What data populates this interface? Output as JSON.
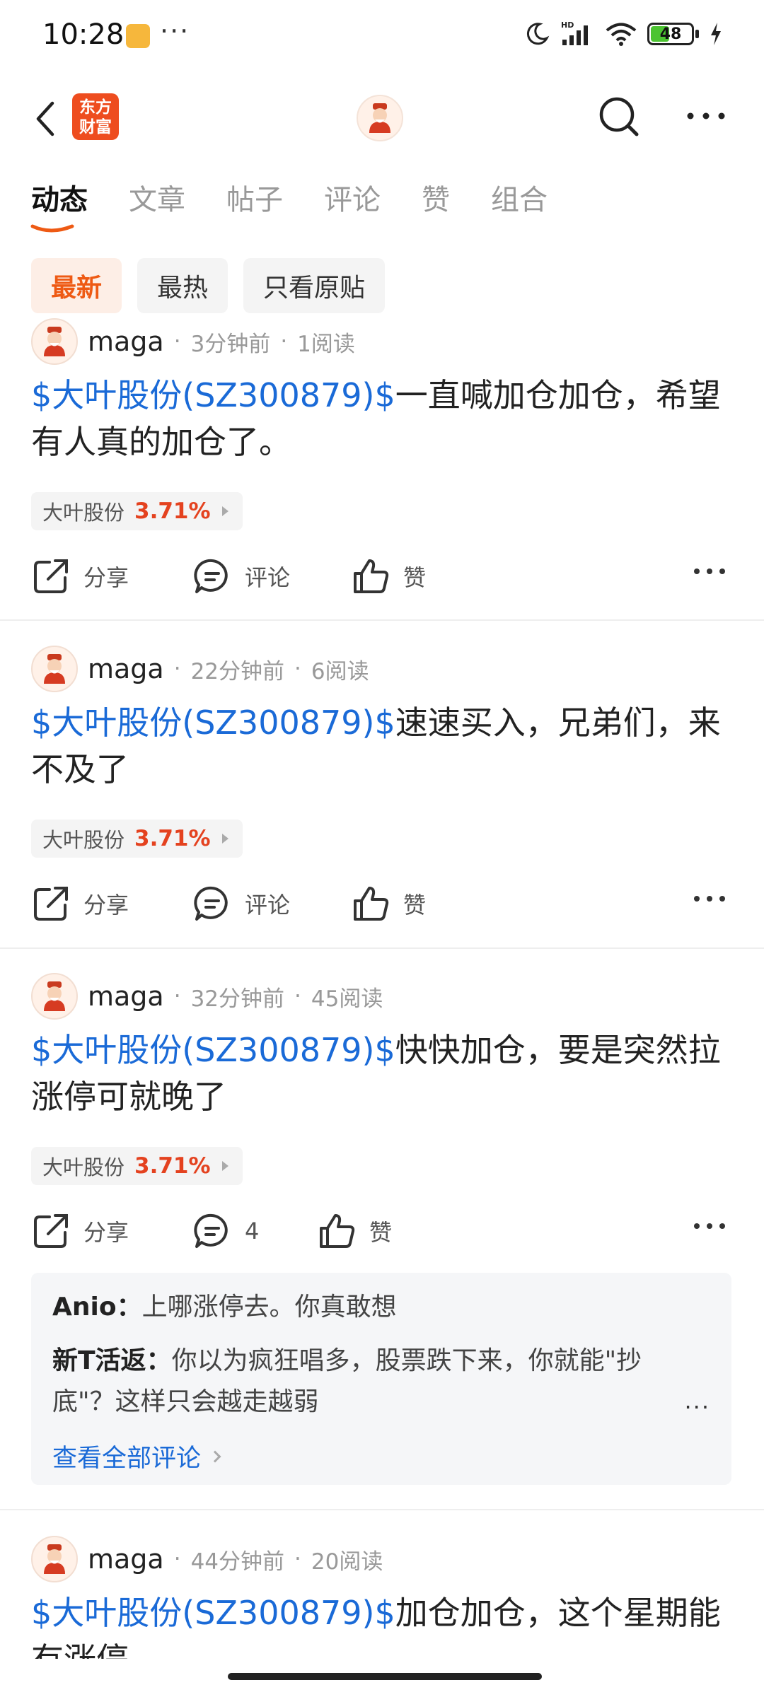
{
  "status_bar": {
    "time": "10:28",
    "more": "···",
    "signal_label": "HD",
    "battery": "48"
  },
  "nav": {
    "brand_text": "东方\n财富"
  },
  "tabs": [
    {
      "label": "动态",
      "active": true
    },
    {
      "label": "文章"
    },
    {
      "label": "帖子"
    },
    {
      "label": "评论"
    },
    {
      "label": "赞"
    },
    {
      "label": "组合"
    }
  ],
  "filters": [
    {
      "label": "最新",
      "active": true
    },
    {
      "label": "最热"
    },
    {
      "label": "只看原贴"
    }
  ],
  "colors": {
    "accent": "#ee5a14",
    "link": "#1a6ad7",
    "rise": "#e4421f"
  },
  "actions": {
    "share": "分享",
    "comment": "评论",
    "like": "赞"
  },
  "posts": [
    {
      "user": "maga",
      "time": "3分钟前",
      "reads": "1阅读",
      "stock_link": "$大叶股份(SZ300879)$",
      "text": "一直喊加仓加仓，希望有人真的加仓了。",
      "tag_name": "大叶股份",
      "tag_pct": "3.71%"
    },
    {
      "user": "maga",
      "time": "22分钟前",
      "reads": "6阅读",
      "stock_link": "$大叶股份(SZ300879)$",
      "text": "速速买入，兄弟们，来不及了",
      "tag_name": "大叶股份",
      "tag_pct": "3.71%"
    },
    {
      "user": "maga",
      "time": "32分钟前",
      "reads": "45阅读",
      "stock_link": "$大叶股份(SZ300879)$",
      "text": "快快加仓，要是突然拉涨停可就晚了",
      "tag_name": "大叶股份",
      "tag_pct": "3.71%",
      "comment_count": "4",
      "comments": [
        {
          "author": "Anio：",
          "text": "上哪涨停去。你真敢想"
        },
        {
          "author": "新T活返：",
          "text": "你以为疯狂唱多，股票跌下来，你就能\"抄底\"？这样只会越走越弱"
        }
      ],
      "comments_more": "...",
      "view_all": "查看全部评论"
    },
    {
      "user": "maga",
      "time": "44分钟前",
      "reads": "20阅读",
      "stock_link": "$大叶股份(SZ300879)$",
      "text": "加仓加仓，这个星期能有涨停"
    }
  ]
}
